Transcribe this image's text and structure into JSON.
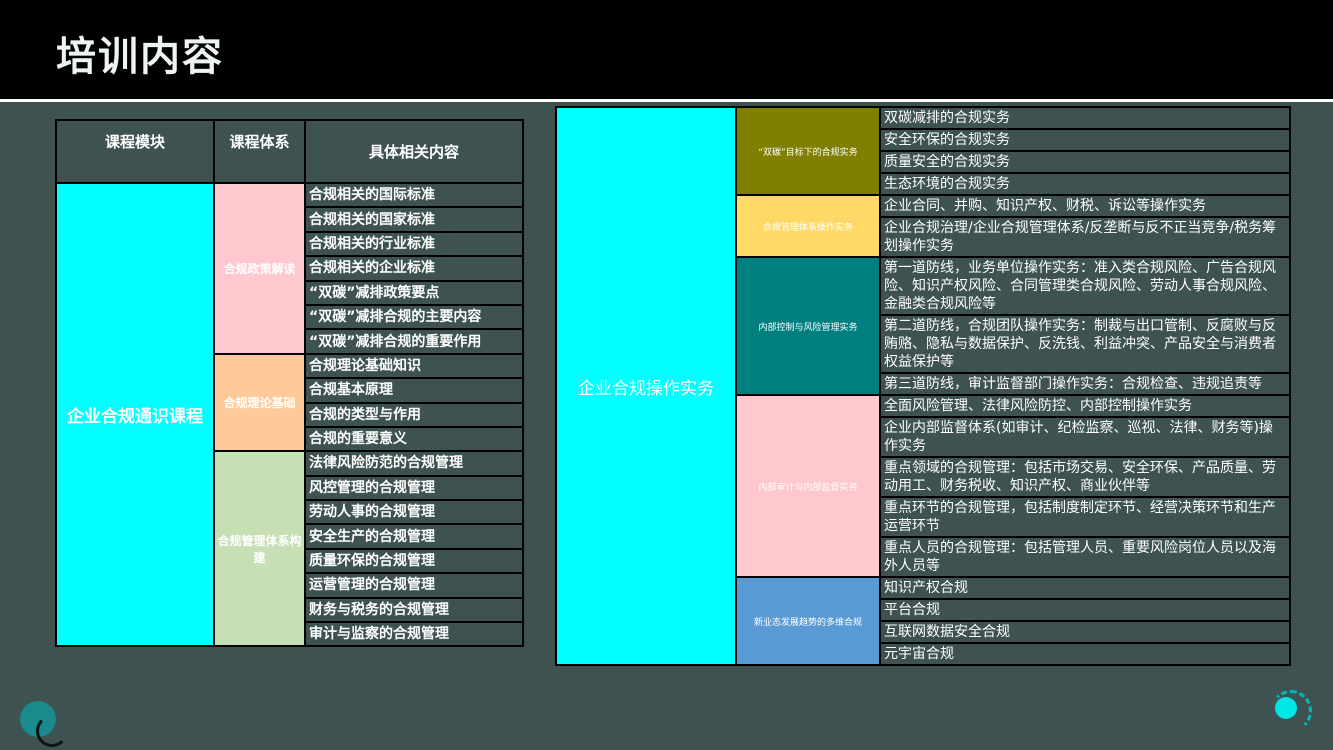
{
  "title": "培训内容",
  "colors": {
    "background": "#3f5252",
    "header": "#000000",
    "cyan": "#00ffff",
    "pink": "#ffc7ce",
    "peach": "#ffc99a",
    "light_green": "#c6dfb4",
    "olive": "#808000",
    "yellow": "#ffd966",
    "teal": "#007f7f",
    "blue": "#5b9bd5"
  },
  "left_table": {
    "headers": [
      "课程模块",
      "课程体系",
      "具体相关内容"
    ],
    "module": "企业合规通识课程",
    "systems": [
      {
        "name": "合规政策解读",
        "color": "#ffc7ce",
        "items": [
          "合规相关的国际标准",
          "合规相关的国家标准",
          "合规相关的行业标准",
          "合规相关的企业标准",
          "“双碳”减排政策要点",
          "“双碳”减排合规的主要内容",
          "“双碳”减排合规的重要作用"
        ]
      },
      {
        "name": "合规理论基础",
        "color": "#ffc99a",
        "items": [
          "合规理论基础知识",
          "合规基本原理",
          "合规的类型与作用",
          "合规的重要意义"
        ]
      },
      {
        "name": "合规管理体系构建",
        "color": "#c6dfb4",
        "items": [
          "法律风险防范的合规管理",
          "风控管理的合规管理",
          "劳动人事的合规管理",
          "安全生产的合规管理",
          "质量环保的合规管理",
          "运营管理的合规管理",
          "财务与税务的合规管理",
          "审计与监察的合规管理"
        ]
      }
    ]
  },
  "right_table": {
    "module": "企业合规操作实务",
    "systems": [
      {
        "name": "“双碳”目标下的合规实务",
        "color": "#808000",
        "items": [
          "双碳减排的合规实务",
          "安全环保的合规实务",
          "质量安全的合规实务",
          "生态环境的合规实务"
        ]
      },
      {
        "name": "合规管理体系操作实务",
        "color": "#ffd966",
        "items": [
          "企业合同、并购、知识产权、财税、诉讼等操作实务",
          "企业合规治理/企业合规管理体系/反垄断与反不正当竞争/税务筹划操作实务"
        ]
      },
      {
        "name": "内部控制与风险管理实务",
        "color": "#007f7f",
        "items": [
          "第一道防线，业务单位操作实务：准入类合规风险、广告合规风险、知识产权风险、合同管理类合规风险、劳动人事合规风险、金融类合规风险等",
          "第二道防线，合规团队操作实务：制裁与出口管制、反腐败与反贿赂、隐私与数据保护、反洗钱、利益冲突、产品安全与消费者权益保护等",
          "第三道防线，审计监督部门操作实务：合规检查、违规追责等"
        ]
      },
      {
        "name": "内部审计与内部监督实务",
        "color": "#ffc7ce",
        "items": [
          "全面风险管理、法律风险防控、内部控制操作实务",
          "企业内部监督体系(如审计、纪检监察、巡视、法律、财务等)操作实务",
          "重点领域的合规管理：包括市场交易、安全环保、产品质量、劳动用工、财务税收、知识产权、商业伙伴等",
          "重点环节的合规管理，包括制度制定环节、经营决策环节和生产运营环节",
          "重点人员的合规管理：包括管理人员、重要风险岗位人员以及海外人员等"
        ]
      },
      {
        "name": "新业态发展趋势的多维合规",
        "color": "#5b9bd5",
        "items": [
          "知识产权合规",
          "平台合规",
          "互联网数据安全合规",
          "元宇宙合规"
        ]
      }
    ]
  }
}
